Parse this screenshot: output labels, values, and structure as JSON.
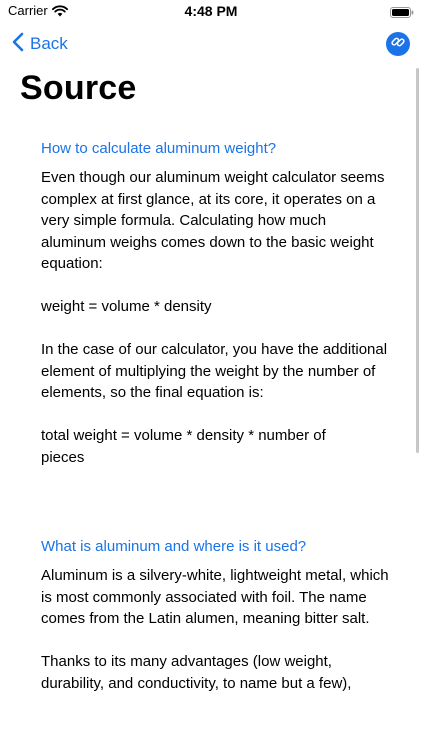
{
  "status_bar": {
    "carrier": "Carrier",
    "time": "4:48 PM",
    "icons": [
      "wifi-icon",
      "battery-icon"
    ]
  },
  "nav": {
    "back_label": "Back",
    "back_icon": "chevron-left-icon",
    "action_icon": "link-icon",
    "accent_color": "#1a73e8"
  },
  "page": {
    "title": "Source"
  },
  "sections": [
    {
      "heading": "How to calculate aluminum weight?",
      "paragraphs": [
        "Even though our aluminum weight calculator seems complex at first glance, at its core, it operates on a very simple formula. Calculating how much aluminum weighs comes down to the basic weight equation:",
        "weight = volume * density",
        "In the case of our calculator, you have the additional element of multiplying the weight by the number of elements, so the final equation is:",
        "total weight = volume * density * number of pieces"
      ]
    },
    {
      "heading": "What is aluminum and where is it used?",
      "paragraphs": [
        "Aluminum is a silvery-white, lightweight metal, which is most commonly associated with foil. The name comes from the Latin alumen, meaning bitter salt.",
        "Thanks to its many advantages (low weight, durability, and conductivity, to name but a few),"
      ]
    }
  ]
}
